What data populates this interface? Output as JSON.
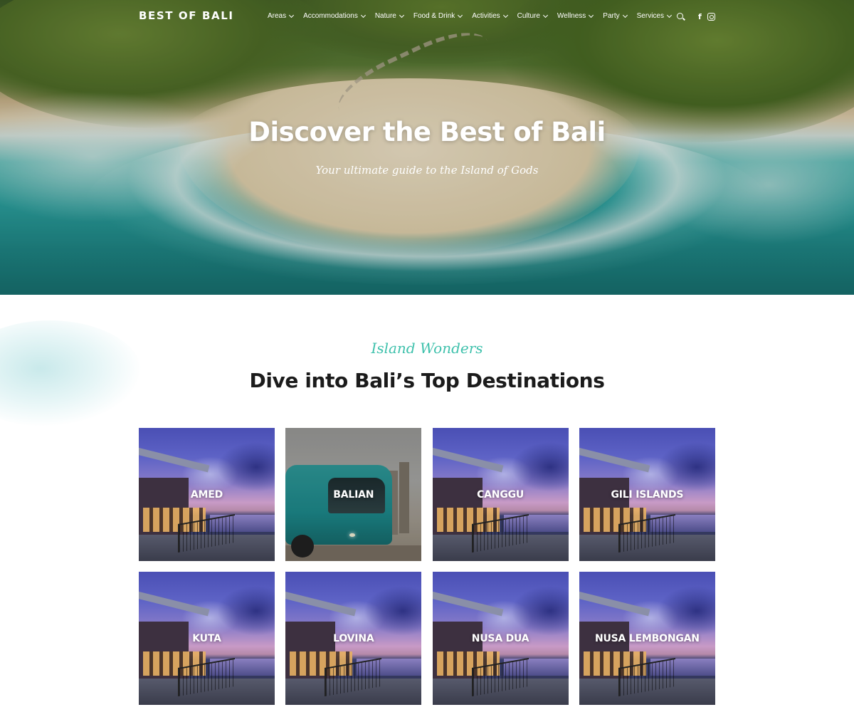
{
  "site": {
    "logo": "BEST OF BALI"
  },
  "nav": {
    "items": [
      {
        "label": "Areas",
        "name": "areas"
      },
      {
        "label": "Accommodations",
        "name": "accommodations"
      },
      {
        "label": "Nature",
        "name": "nature"
      },
      {
        "label": "Food & Drink",
        "name": "food-drink"
      },
      {
        "label": "Activities",
        "name": "activities"
      },
      {
        "label": "Culture",
        "name": "culture"
      },
      {
        "label": "Wellness",
        "name": "wellness"
      },
      {
        "label": "Party",
        "name": "party"
      },
      {
        "label": "Services",
        "name": "services"
      }
    ],
    "icons": {
      "search": "search-icon",
      "facebook": "facebook-icon",
      "instagram": "instagram-icon"
    }
  },
  "hero": {
    "title": "Discover the Best of Bali",
    "subtitle": "Your ultimate guide to the Island of Gods"
  },
  "destinations": {
    "eyebrow": "Island Wonders",
    "title": "Dive into Bali’s Top Destinations",
    "cards": [
      {
        "label": "AMED",
        "image": "resort"
      },
      {
        "label": "BALIAN",
        "image": "bus"
      },
      {
        "label": "CANGGU",
        "image": "resort"
      },
      {
        "label": "GILI ISLANDS",
        "image": "resort"
      },
      {
        "label": "KUTA",
        "image": "resort"
      },
      {
        "label": "LOVINA",
        "image": "resort"
      },
      {
        "label": "NUSA DUA",
        "image": "resort"
      },
      {
        "label": "NUSA LEMBONGAN",
        "image": "resort"
      }
    ]
  },
  "colors": {
    "accent": "#3fc1ac",
    "heading": "#1b1b1b",
    "text_light": "#ffffff"
  }
}
